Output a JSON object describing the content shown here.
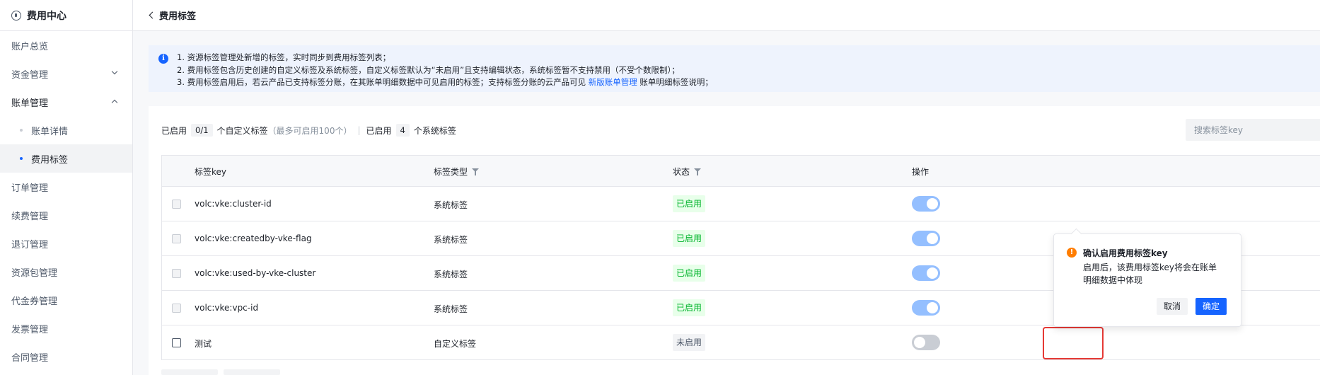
{
  "sidebar": {
    "title": "费用中心",
    "items": [
      {
        "label": "账户总览"
      },
      {
        "label": "资金管理"
      },
      {
        "label": "账单管理"
      },
      {
        "label": "账单详情"
      },
      {
        "label": "费用标签"
      },
      {
        "label": "订单管理"
      },
      {
        "label": "续费管理"
      },
      {
        "label": "退订管理"
      },
      {
        "label": "资源包管理"
      },
      {
        "label": "代金券管理"
      },
      {
        "label": "发票管理"
      },
      {
        "label": "合同管理"
      }
    ]
  },
  "header": {
    "title": "费用标签"
  },
  "notice": {
    "line1": "1. 资源标签管理处新增的标签，实时同步到费用标签列表；",
    "line2": "2. 费用标签包含历史创建的自定义标签及系统标签，自定义标签默认为“未启用”且支持编辑状态，系统标签暂不支持禁用（不受个数限制）；",
    "line3_pre": "3. 费用标签启用后，若云产品已支持标签分账，在其账单明细数据中可见启用的标签；支持标签分账的云产品可见 ",
    "line3_link": "新版账单管理",
    "line3_post": " 账单明细标签说明；"
  },
  "stats": {
    "enabled_label": "已启用",
    "custom_count": "0/1",
    "custom_label": "个自定义标签",
    "custom_limit": "（最多可启用100个）",
    "separator": "|",
    "enabled_label2": "已启用",
    "system_count": "4",
    "system_label": "个系统标签"
  },
  "search": {
    "placeholder": "搜索标签key"
  },
  "table": {
    "headers": {
      "key": "标签key",
      "type": "标签类型",
      "status": "状态",
      "action": "操作"
    },
    "rows": [
      {
        "key": "volc:vke:cluster-id",
        "type": "系统标签",
        "status": "已启用",
        "enabled": true
      },
      {
        "key": "volc:vke:createdby-vke-flag",
        "type": "系统标签",
        "status": "已启用",
        "enabled": true
      },
      {
        "key": "volc:vke:used-by-vke-cluster",
        "type": "系统标签",
        "status": "已启用",
        "enabled": true
      },
      {
        "key": "volc:vke:vpc-id",
        "type": "系统标签",
        "status": "已启用",
        "enabled": true
      },
      {
        "key": "测试",
        "type": "自定义标签",
        "status": "未启用",
        "enabled": false
      }
    ]
  },
  "popconfirm": {
    "title": "确认启用费用标签key",
    "body": "启用后，该费用标签key将会在账单明细数据中体现",
    "cancel": "取消",
    "confirm": "确定"
  },
  "colors": {
    "accent": "#1664ff",
    "success": "#00b42a",
    "warning": "#ff7d00",
    "highlight": "#e53935"
  }
}
